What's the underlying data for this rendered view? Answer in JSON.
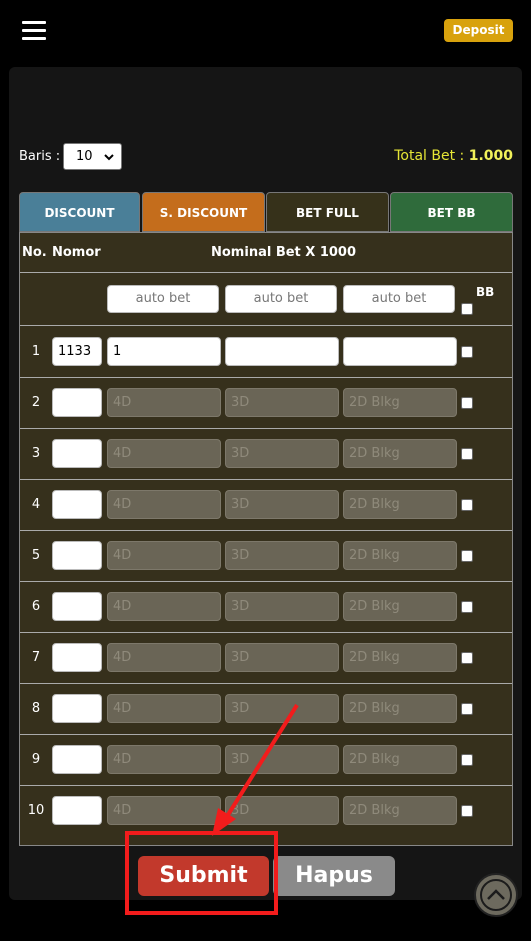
{
  "header": {
    "menu_icon": "hamburger-menu-icon",
    "deposit_label": "Deposit"
  },
  "controls": {
    "baris_label": "Baris :",
    "baris_value": "10",
    "total_bet_label": "Total Bet :",
    "total_bet_value": "1.000"
  },
  "tabs": [
    {
      "label": "DISCOUNT"
    },
    {
      "label": "S. DISCOUNT"
    },
    {
      "label": "BET FULL"
    },
    {
      "label": "BET BB"
    }
  ],
  "table": {
    "col_no": "No.",
    "col_nomor": "Nomor",
    "col_nominal": "Nominal Bet X 1000",
    "bb_label": "BB",
    "auto_placeholder": "auto bet",
    "rows": [
      {
        "no": "1",
        "nomor": "1133",
        "v4d": "1",
        "v3d": "",
        "v2d": ""
      },
      {
        "no": "2",
        "nomor": "",
        "v4d": "4D",
        "v3d": "3D",
        "v2d": "2D Blkg"
      },
      {
        "no": "3",
        "nomor": "",
        "v4d": "4D",
        "v3d": "3D",
        "v2d": "2D Blkg"
      },
      {
        "no": "4",
        "nomor": "",
        "v4d": "4D",
        "v3d": "3D",
        "v2d": "2D Blkg"
      },
      {
        "no": "5",
        "nomor": "",
        "v4d": "4D",
        "v3d": "3D",
        "v2d": "2D Blkg"
      },
      {
        "no": "6",
        "nomor": "",
        "v4d": "4D",
        "v3d": "3D",
        "v2d": "2D Blkg"
      },
      {
        "no": "7",
        "nomor": "",
        "v4d": "4D",
        "v3d": "3D",
        "v2d": "2D Blkg"
      },
      {
        "no": "8",
        "nomor": "",
        "v4d": "4D",
        "v3d": "3D",
        "v2d": "2D Blkg"
      },
      {
        "no": "9",
        "nomor": "",
        "v4d": "4D",
        "v3d": "3D",
        "v2d": "2D Blkg"
      },
      {
        "no": "10",
        "nomor": "",
        "v4d": "4D",
        "v3d": "3D",
        "v2d": "2D Blkg"
      }
    ]
  },
  "actions": {
    "submit_label": "Submit",
    "hapus_label": "Hapus",
    "scroll_top_icon": "chevron-up-icon"
  },
  "colors": {
    "accent_deposit": "#d8a20d",
    "total_text": "#e6e636",
    "submit": "#c2392c",
    "annotation": "#f21c1c"
  }
}
